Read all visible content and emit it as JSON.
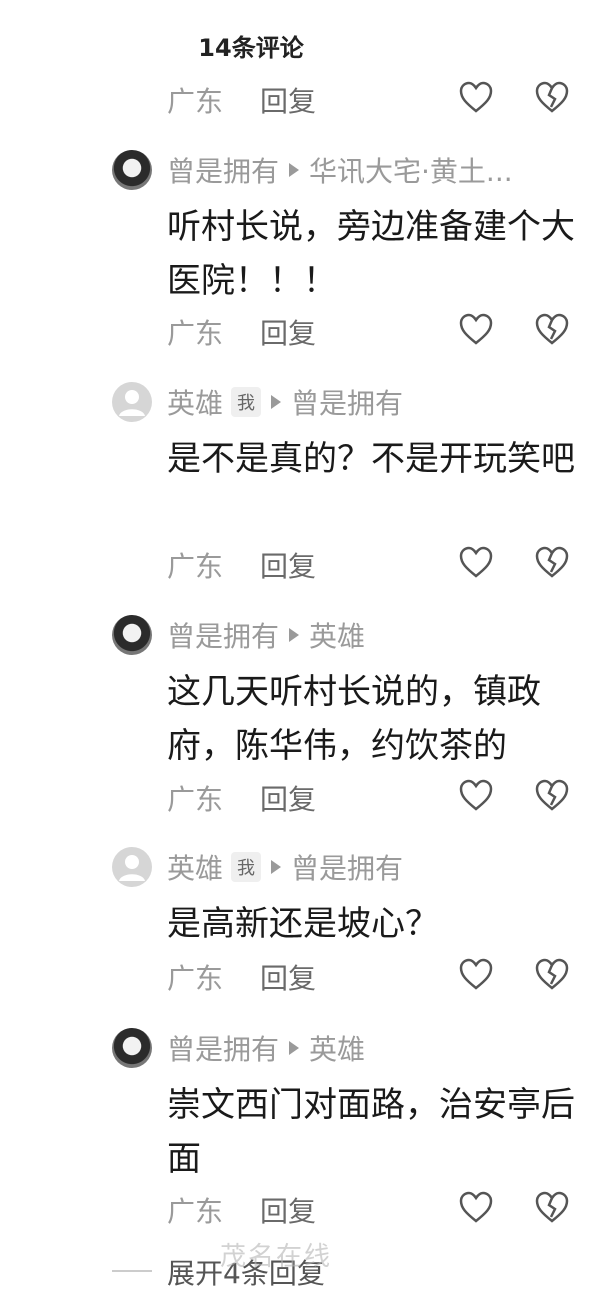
{
  "header": {
    "title": "14条评论"
  },
  "common": {
    "location": "广东",
    "reply_label": "回复"
  },
  "first_actions": {
    "location": "广东",
    "reply": "回复"
  },
  "comments": [
    {
      "user": "曾是拥有",
      "is_me": false,
      "reply_to": "华讯大宅·黄土...",
      "avatar": "photo-avatar",
      "text": "听村长说，旁边准备建个大医院！！！",
      "location": "广东",
      "reply": "回复"
    },
    {
      "user": "英雄",
      "is_me": true,
      "me_badge": "我",
      "reply_to": "曾是拥有",
      "avatar": "default-avatar",
      "text": "是不是真的？不是开玩笑吧",
      "location": "广东",
      "reply": "回复"
    },
    {
      "user": "曾是拥有",
      "is_me": false,
      "reply_to": "英雄",
      "avatar": "photo-avatar",
      "text": "这几天听村长说的，镇政府，陈华伟，约饮茶的",
      "location": "广东",
      "reply": "回复"
    },
    {
      "user": "英雄",
      "is_me": true,
      "me_badge": "我",
      "reply_to": "曾是拥有",
      "avatar": "default-avatar",
      "text": "是高新还是坡心？",
      "location": "广东",
      "reply": "回复"
    },
    {
      "user": "曾是拥有",
      "is_me": false,
      "reply_to": "英雄",
      "avatar": "photo-avatar",
      "text": "崇文西门对面路，治安亭后面",
      "location": "广东",
      "reply": "回复"
    }
  ],
  "footer": {
    "expand_label": "展开4条回复"
  },
  "watermark": "茂名在线",
  "icons": {
    "like": "heart-outline-icon",
    "dislike": "broken-heart-icon"
  }
}
